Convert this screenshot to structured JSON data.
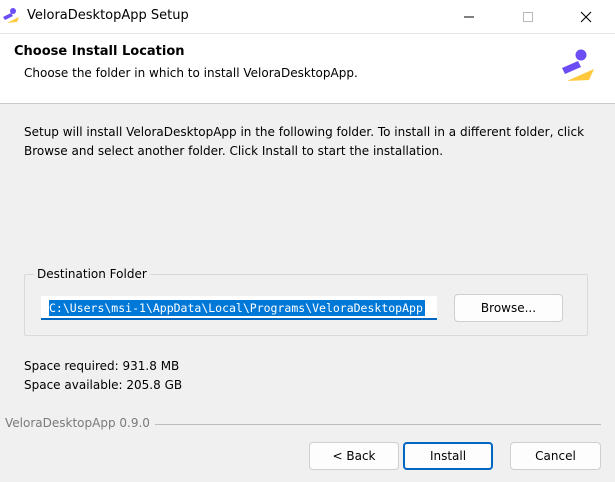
{
  "window": {
    "title": "VeloraDesktopApp Setup",
    "icon": "velora-logo-icon",
    "controls": [
      "minimize-icon",
      "maximize-icon",
      "close-icon"
    ]
  },
  "header": {
    "title": "Choose Install Location",
    "subtitle": "Choose the folder in which to install VeloraDesktopApp.",
    "logo": "velora-logo-icon"
  },
  "body": {
    "intro": "Setup will install VeloraDesktopApp in the following folder. To install in a different folder, click Browse and select another folder. Click Install to start the installation.",
    "destination_group_label": "Destination Folder",
    "destination_path": "C:\\Users\\msi-1\\AppData\\Local\\Programs\\VeloraDesktopApp",
    "browse_label": "Browse...",
    "space_required": "Space required: 931.8 MB",
    "space_available": "Space available: 205.8 GB"
  },
  "footer": {
    "branding": "VeloraDesktopApp 0.9.0",
    "back_label": "< Back",
    "install_label": "Install",
    "cancel_label": "Cancel"
  },
  "colors": {
    "accent": "#0067c0",
    "selection": "#0078d7",
    "logo_purple": "#6c4df5",
    "logo_yellow": "#ffc83d"
  }
}
